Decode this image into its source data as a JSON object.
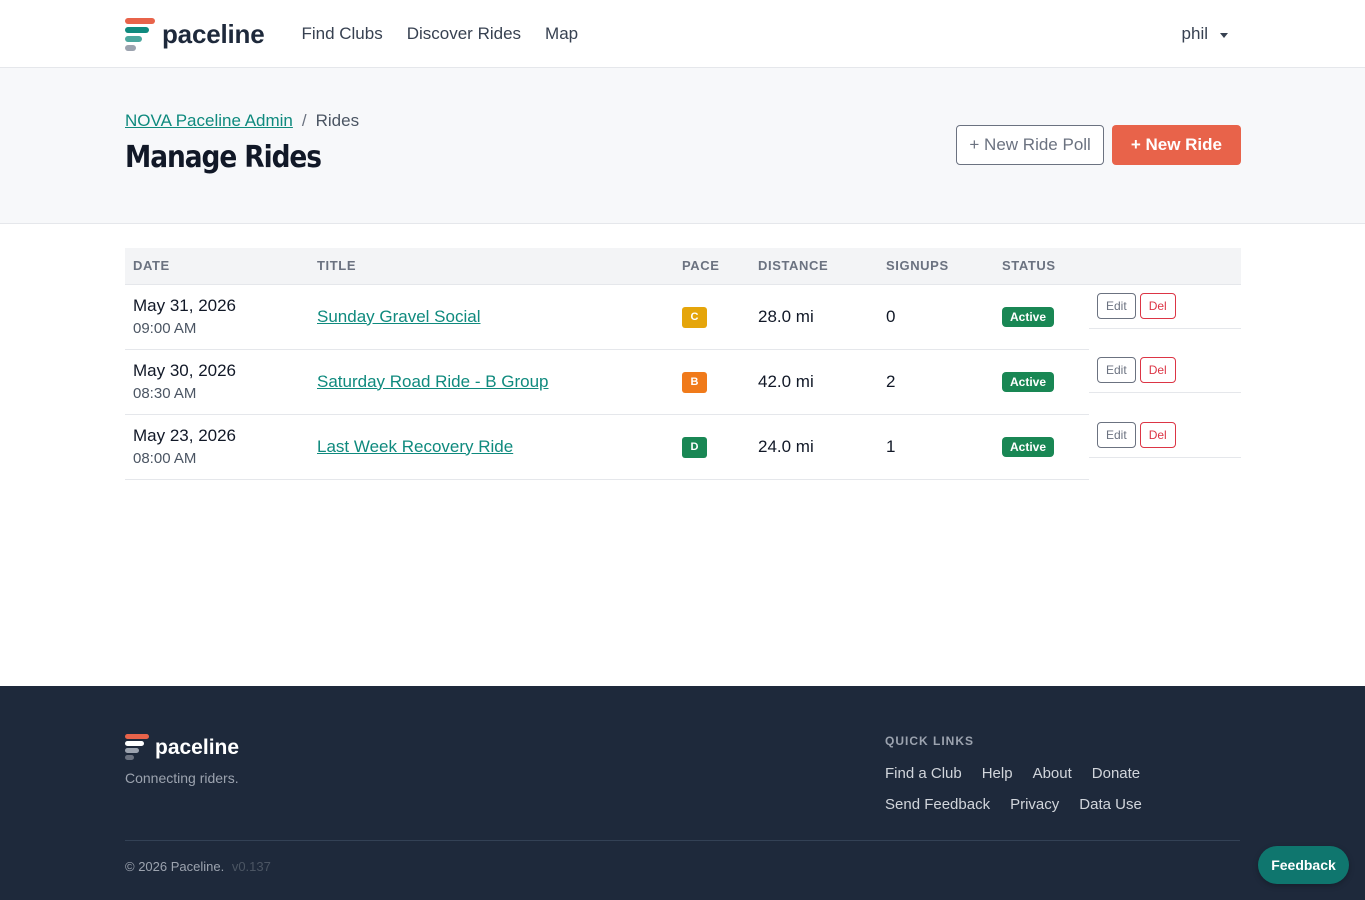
{
  "brand": {
    "name": "paceline",
    "logo_colors": [
      "#e8634a",
      "#0f8a7e",
      "#9ca3af"
    ]
  },
  "nav": {
    "links": [
      "Find Clubs",
      "Discover Rides",
      "Map"
    ],
    "user": "phil"
  },
  "header": {
    "breadcrumb": {
      "parent": "NOVA Paceline Admin",
      "separator": "/",
      "current": "Rides"
    },
    "title": "Manage Rides",
    "new_poll_label": "+ New Ride Poll",
    "new_ride_label": "+ New Ride"
  },
  "table": {
    "columns": [
      "DATE",
      "TITLE",
      "PACE",
      "DISTANCE",
      "SIGNUPS",
      "STATUS"
    ],
    "rows": [
      {
        "date": "May 31, 2026",
        "time": "09:00 AM",
        "title": "Sunday Gravel Social",
        "pace": "C",
        "pace_color": "#e5a50a",
        "distance": "28.0 mi",
        "signups": "0",
        "status": "Active",
        "edit": "Edit",
        "del": "Del"
      },
      {
        "date": "May 30, 2026",
        "time": "08:30 AM",
        "title": "Saturday Road Ride - B Group",
        "pace": "B",
        "pace_color": "#f07a1a",
        "distance": "42.0 mi",
        "signups": "2",
        "status": "Active",
        "edit": "Edit",
        "del": "Del"
      },
      {
        "date": "May 23, 2026",
        "time": "08:00 AM",
        "title": "Last Week Recovery Ride",
        "pace": "D",
        "pace_color": "#198754",
        "distance": "24.0 mi",
        "signups": "1",
        "status": "Active",
        "edit": "Edit",
        "del": "Del"
      }
    ]
  },
  "footer": {
    "brand": "paceline",
    "tagline": "Connecting riders.",
    "quick_links_title": "QUICK LINKS",
    "quick_links_row1": [
      "Find a Club",
      "Help",
      "About",
      "Donate"
    ],
    "quick_links_row2": [
      "Send Feedback",
      "Privacy",
      "Data Use"
    ],
    "copyright": "© 2026 Paceline.",
    "version": "v0.137"
  },
  "feedback_label": "Feedback"
}
